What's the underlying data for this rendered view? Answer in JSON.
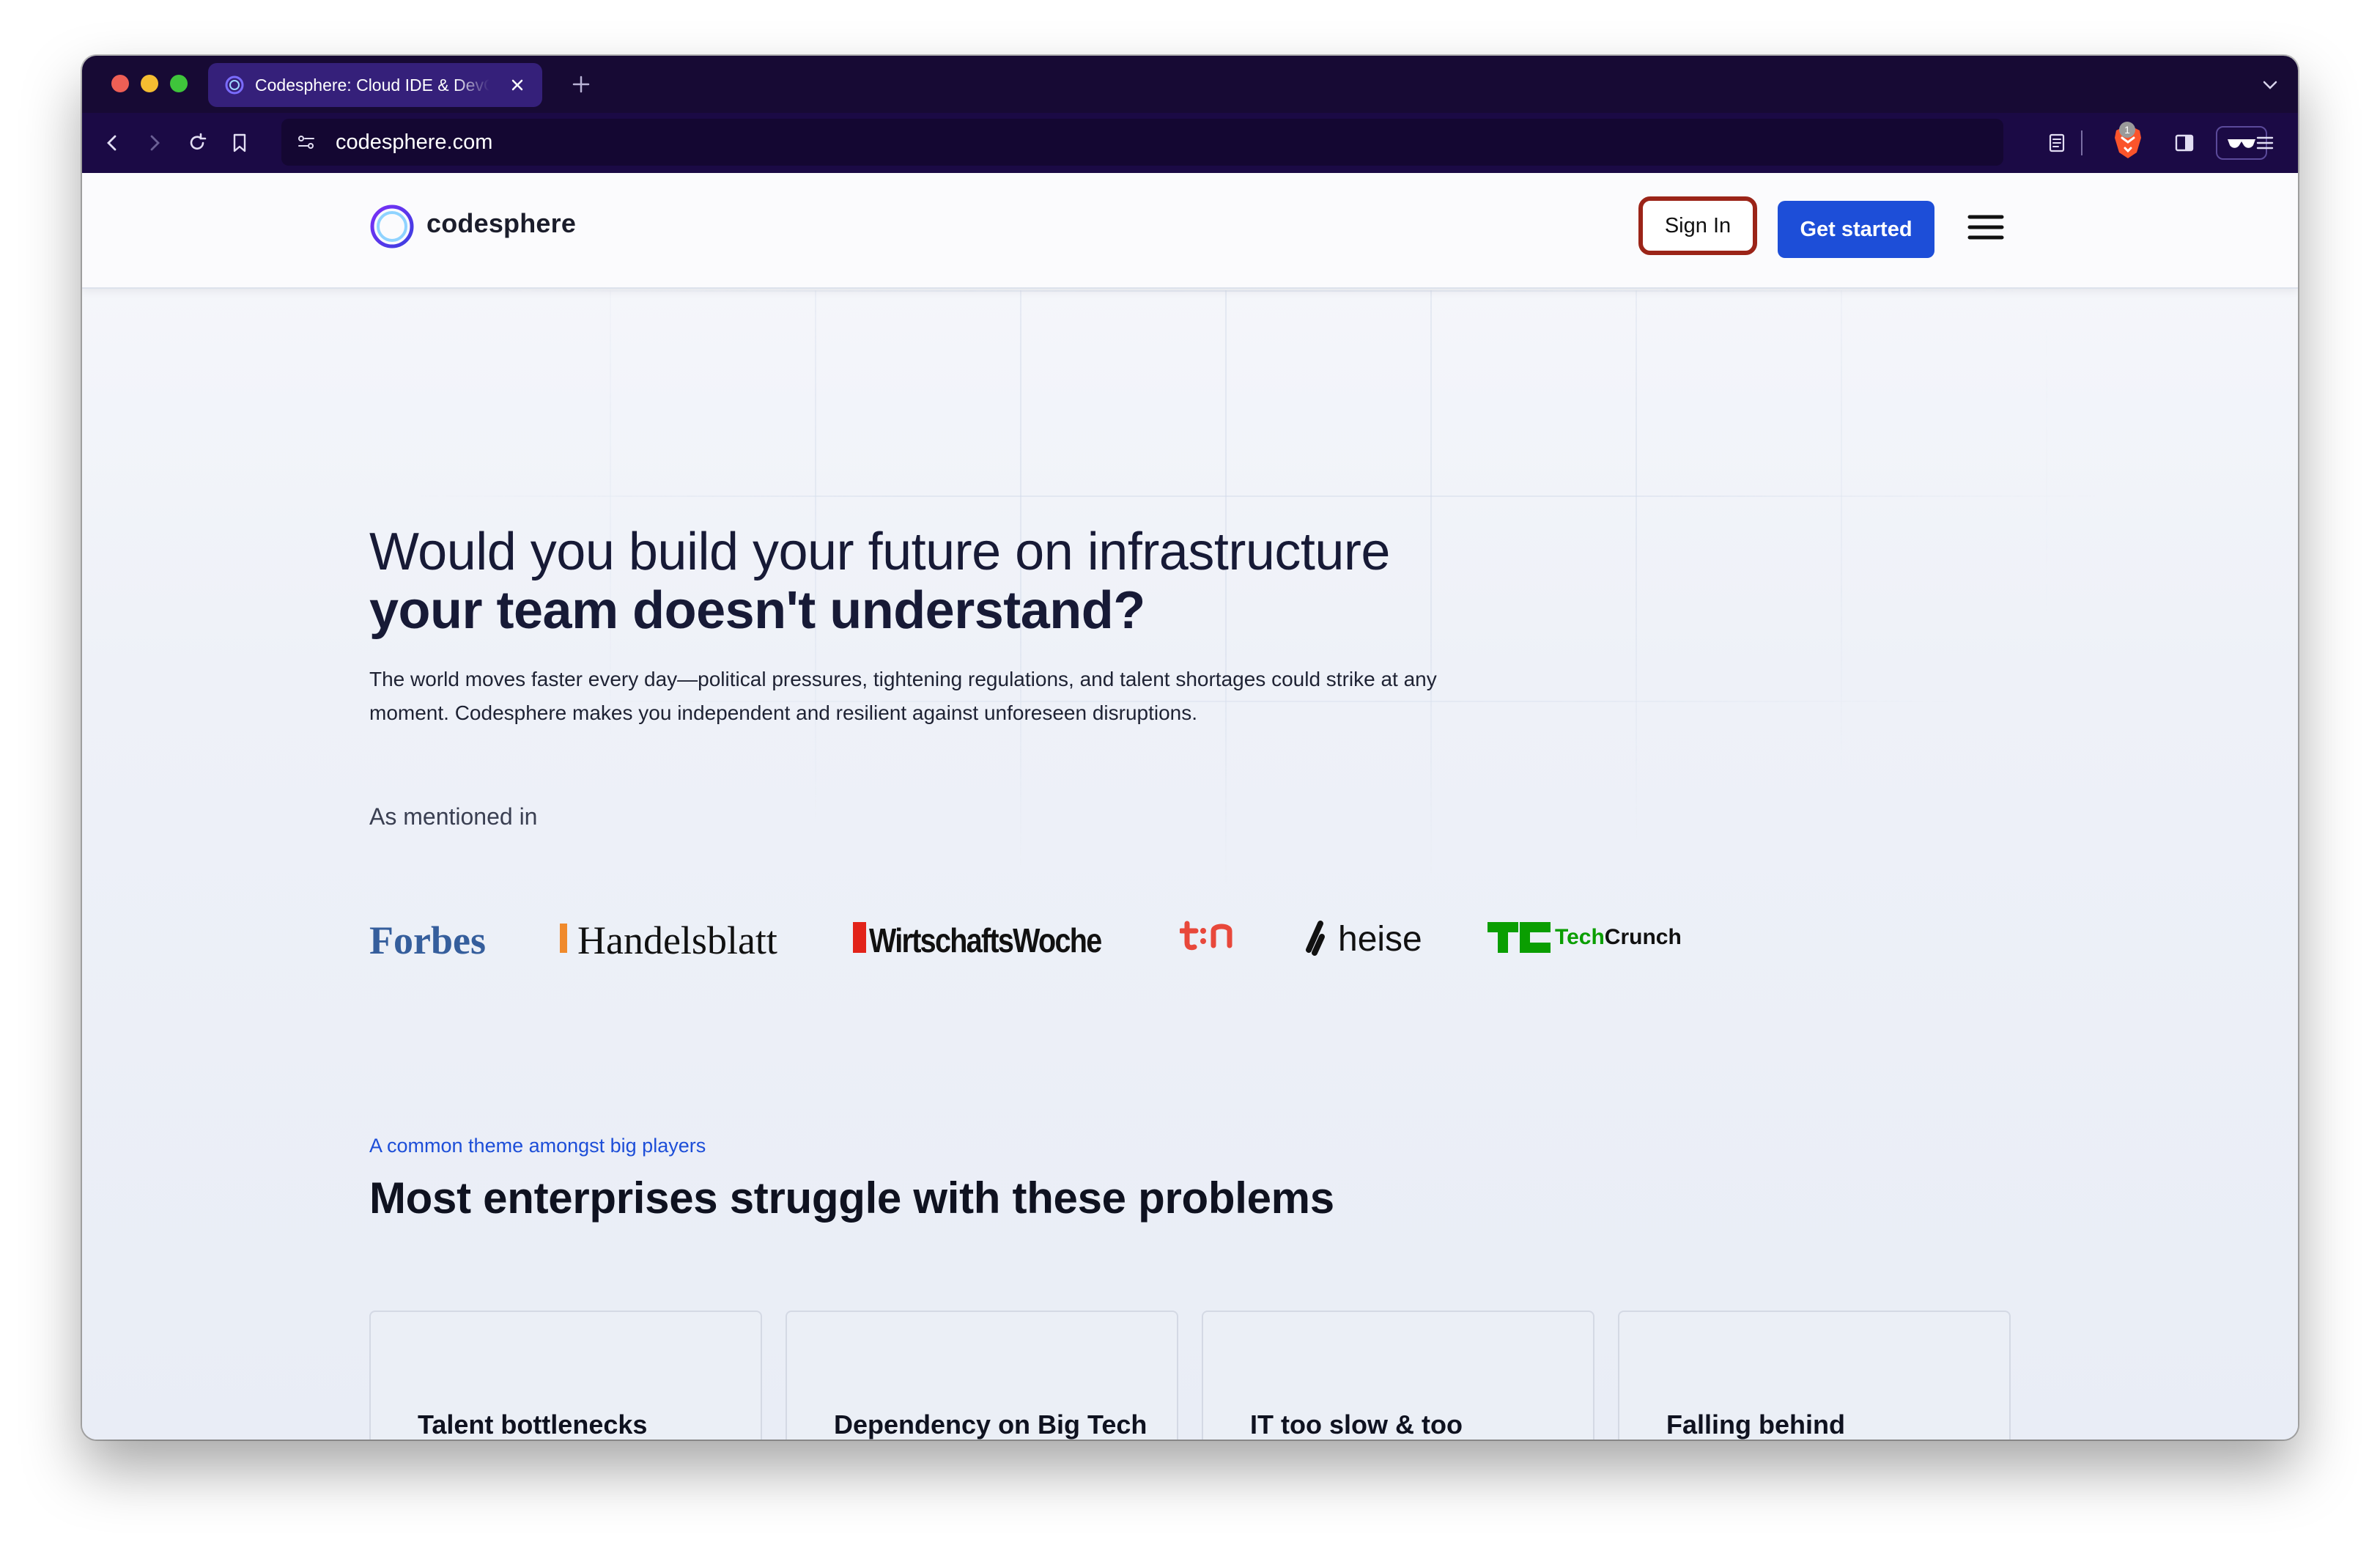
{
  "browser": {
    "tab_title": "Codesphere: Cloud IDE & DevOps",
    "url": "codesphere.com",
    "shield_badge_count": "1"
  },
  "header": {
    "logo_text": "codesphere",
    "sign_in_label": "Sign In",
    "get_started_label": "Get started"
  },
  "hero": {
    "title_line1": "Would you build your future on infrastructure",
    "title_line2": "your team doesn't understand?",
    "subtitle": "The world moves faster every day—political pressures, tightening regulations, and talent shortages could strike at any moment. Codesphere makes you independent and resilient against unforeseen disruptions."
  },
  "press": {
    "label": "As mentioned in",
    "logos": [
      "Forbes",
      "Handelsblatt",
      "WirtschaftsWoche",
      "t3n",
      "heise",
      "TechCrunch"
    ],
    "techcrunch_tech": "Tech",
    "techcrunch_crunch": "Crunch"
  },
  "problems": {
    "eyebrow": "A common theme amongst big players",
    "title": "Most enterprises struggle with these problems",
    "cards": [
      {
        "title": "Talent bottlenecks"
      },
      {
        "title": "Dependency on Big Tech"
      },
      {
        "title": "IT too slow & too expensive"
      },
      {
        "title": "Falling behind competition"
      }
    ]
  },
  "colors": {
    "brand_purple": "#170a34",
    "primary_blue": "#1d4ed8",
    "highlight_red": "#9b2418"
  }
}
